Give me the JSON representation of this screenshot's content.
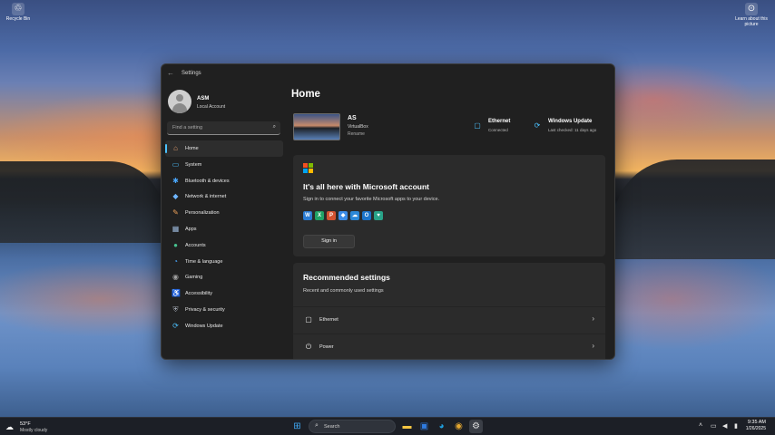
{
  "desktop": {
    "icons": [
      {
        "label": "Recycle Bin",
        "icon": "recycle-bin-icon"
      },
      {
        "label": "Learn about this picture",
        "icon": "learn-picture-icon"
      }
    ]
  },
  "window": {
    "title": "Settings",
    "back": "←"
  },
  "sidebar": {
    "user_name": "ASM",
    "user_type": "Local Account",
    "search_placeholder": "Find a setting",
    "items": [
      {
        "label": "Home",
        "icon": "home-icon",
        "glyph": "⌂",
        "color": "#e9a070",
        "active": true
      },
      {
        "label": "System",
        "icon": "system-icon",
        "glyph": "▭",
        "color": "#4cc2ff"
      },
      {
        "label": "Bluetooth & devices",
        "icon": "bluetooth-icon",
        "glyph": "✱",
        "color": "#4aa8ff"
      },
      {
        "label": "Network & internet",
        "icon": "network-icon",
        "glyph": "◆",
        "color": "#6fb6ff"
      },
      {
        "label": "Personalization",
        "icon": "brush-icon",
        "glyph": "✎",
        "color": "#f0a35a"
      },
      {
        "label": "Apps",
        "icon": "apps-icon",
        "glyph": "▦",
        "color": "#9ab6d8"
      },
      {
        "label": "Accounts",
        "icon": "accounts-icon",
        "glyph": "●",
        "color": "#47c28f"
      },
      {
        "label": "Time & language",
        "icon": "globe-icon",
        "glyph": "◔",
        "color": "#4aa8ff"
      },
      {
        "label": "Gaming",
        "icon": "gaming-icon",
        "glyph": "◉",
        "color": "#a0a0a0"
      },
      {
        "label": "Accessibility",
        "icon": "accessibility-icon",
        "glyph": "♿",
        "color": "#4cc2ff"
      },
      {
        "label": "Privacy & security",
        "icon": "shield-icon",
        "glyph": "⛨",
        "color": "#a0a6b0"
      },
      {
        "label": "Windows Update",
        "icon": "update-icon",
        "glyph": "⟳",
        "color": "#4cc2ff"
      }
    ]
  },
  "main": {
    "title": "Home",
    "device": {
      "name": "AS",
      "model": "VirtualBox",
      "rename": "Rename"
    },
    "status": [
      {
        "title": "Ethernet",
        "sub": "Connected",
        "icon": "ethernet-icon",
        "glyph": "▢"
      },
      {
        "title": "Windows Update",
        "sub": "Last checked: 11 days ago",
        "icon": "windows-update-icon",
        "glyph": "⟳"
      }
    ],
    "ms_card": {
      "title": "It's all here with Microsoft account",
      "description": "Sign in to connect your favorite Microsoft apps to your device.",
      "button": "Sign in",
      "apps": [
        {
          "icon": "word-icon",
          "glyph": "W",
          "color": "#2b7cd3"
        },
        {
          "icon": "excel-icon",
          "glyph": "X",
          "color": "#21a366"
        },
        {
          "icon": "powerpoint-icon",
          "glyph": "P",
          "color": "#d35230"
        },
        {
          "icon": "defender-icon",
          "glyph": "◆",
          "color": "#3c8ce6"
        },
        {
          "icon": "onedrive-icon",
          "glyph": "☁",
          "color": "#2b88d8"
        },
        {
          "icon": "outlook-icon",
          "glyph": "O",
          "color": "#1c74c9"
        },
        {
          "icon": "family-icon",
          "glyph": "♥",
          "color": "#29a389"
        }
      ]
    },
    "recommended": {
      "title": "Recommended settings",
      "description": "Recent and commonly used settings",
      "items": [
        {
          "label": "Ethernet",
          "icon": "ethernet-icon",
          "glyph": "▢"
        },
        {
          "label": "Power",
          "icon": "power-icon",
          "glyph": "⏻"
        }
      ]
    }
  },
  "taskbar": {
    "weather_temp": "53°F",
    "weather_desc": "Mostly cloudy",
    "search_label": "Search",
    "time": "9:35 AM",
    "date": "1/26/2025",
    "colors": {
      "start": "#3fa9f5",
      "explorer": "#f4c542",
      "store": "#2f7be0",
      "edge": "#1fa1e0",
      "chrome": "#e5a830"
    }
  }
}
